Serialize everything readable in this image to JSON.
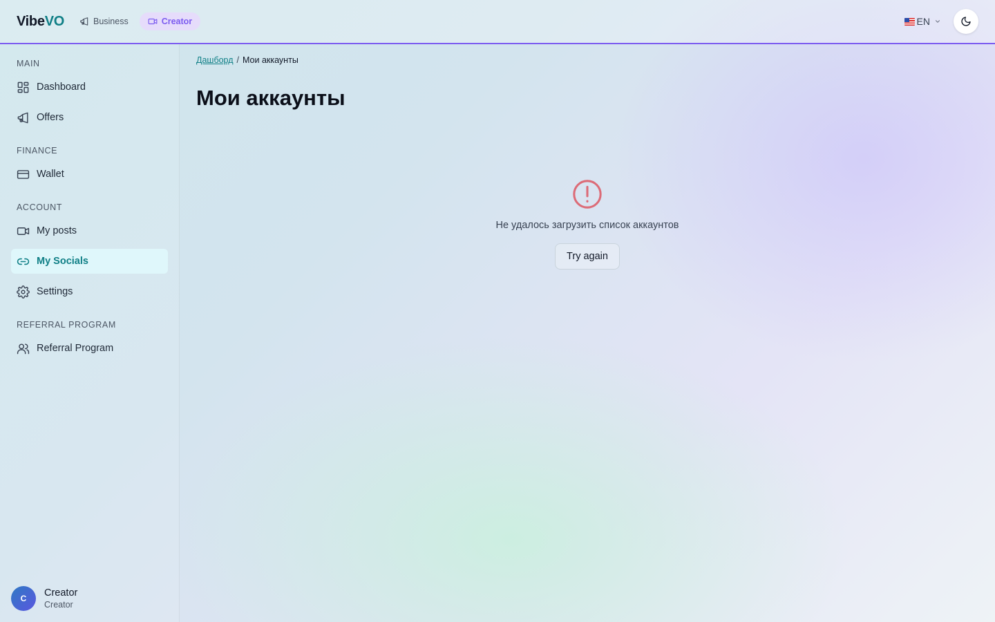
{
  "header": {
    "logo_main": "Vibe",
    "logo_accent": "VO",
    "modes": [
      {
        "label": "Business",
        "icon": "megaphone-icon",
        "active": false
      },
      {
        "label": "Creator",
        "icon": "video-icon",
        "active": true
      }
    ],
    "language": "EN",
    "theme_icon": "moon-icon"
  },
  "sidebar": {
    "sections": [
      {
        "label": "MAIN",
        "items": [
          {
            "label": "Dashboard",
            "icon": "dashboard-icon"
          },
          {
            "label": "Offers",
            "icon": "megaphone-icon"
          }
        ]
      },
      {
        "label": "FINANCE",
        "items": [
          {
            "label": "Wallet",
            "icon": "wallet-icon"
          }
        ]
      },
      {
        "label": "ACCOUNT",
        "items": [
          {
            "label": "My posts",
            "icon": "video-icon"
          },
          {
            "label": "My Socials",
            "icon": "link-icon",
            "active": true
          },
          {
            "label": "Settings",
            "icon": "gear-icon"
          }
        ]
      },
      {
        "label": "REFERRAL PROGRAM",
        "items": [
          {
            "label": "Referral Program",
            "icon": "users-icon"
          }
        ]
      }
    ],
    "user": {
      "initial": "C",
      "name": "Creator",
      "role": "Creator"
    }
  },
  "main": {
    "breadcrumb": {
      "link": "Дашборд",
      "separator": "/",
      "current": "Мои аккаунты"
    },
    "title": "Мои аккаунты",
    "error": {
      "message": "Не удалось загрузить список аккаунтов",
      "retry_label": "Try again",
      "icon_color": "#dc6b77"
    }
  },
  "colors": {
    "accent": "#0f7f86",
    "brand_purple": "#7c5cf0",
    "active_bg": "#dff7fb"
  }
}
